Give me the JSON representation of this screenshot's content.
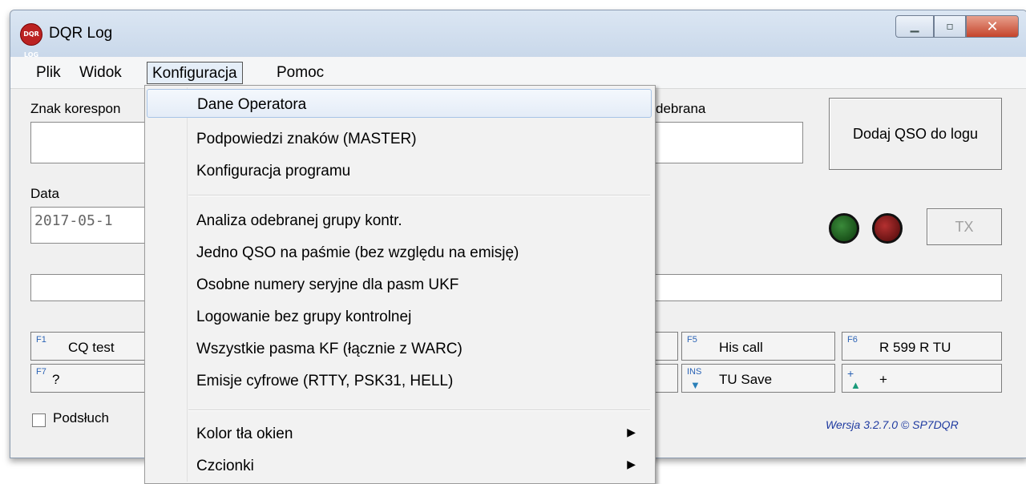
{
  "window": {
    "title": "DQR Log",
    "icon_text": "DQR LOG"
  },
  "menubar": [
    "Plik",
    "Widok",
    "Konfiguracja",
    "Pomoc"
  ],
  "form": {
    "callsign_label": "Znak korespon",
    "received_label": "debrana",
    "date_label": "Data",
    "date_value": "2017-05-1",
    "add_button": "Dodaj QSO do logu",
    "tx_button": "TX"
  },
  "fkeys": [
    {
      "key": "F1",
      "label": "CQ test"
    },
    {
      "key": "F7",
      "label": "?"
    },
    {
      "key": "F5",
      "label": "His call"
    },
    {
      "key": "F6",
      "label": "R 599 R TU"
    },
    {
      "key": "INS",
      "label": "TU Save"
    },
    {
      "key": "+",
      "label": "+"
    }
  ],
  "podsluch_label": "Podsłuch",
  "version": "Wersja 3.2.7.0 © SP7DQR",
  "dropdown": {
    "group1": [
      "Dane Operatora",
      "Podpowiedzi znaków (MASTER)",
      "Konfiguracja programu"
    ],
    "group2": [
      "Analiza odebranej grupy kontr.",
      "Jedno QSO na paśmie (bez względu na emisję)",
      "Osobne numery seryjne dla pasm UKF",
      "Logowanie bez grupy kontrolnej",
      "Wszystkie pasma KF (łącznie z WARC)",
      "Emisje cyfrowe (RTTY, PSK31, HELL)"
    ],
    "group3": [
      "Kolor tła okien",
      "Czcionki"
    ],
    "submenu_arrow": "▶"
  },
  "colors": {
    "accent": "#1e3aa0",
    "highlight": "#a8c4e6"
  }
}
